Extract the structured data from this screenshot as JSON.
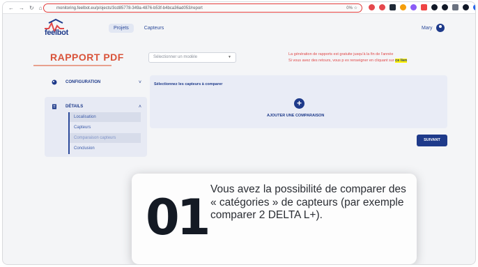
{
  "browser": {
    "url": "monitoring.feelbot.eu/p/ojects/3cd85778-349a-4876-b53f-b4bca36ad053/report",
    "url_right": "0% ☆",
    "nav_icons": [
      "arrow-left-icon",
      "arrow-right-icon",
      "reload-icon",
      "home-icon"
    ],
    "extension_colors": [
      "#e5484d",
      "#e5484d",
      "#1f2937",
      "#f59e0b",
      "#8b5cf6",
      "#ef4444",
      "#111827",
      "#111827",
      "#6b7280",
      "#111827",
      "#2563eb"
    ]
  },
  "app": {
    "logo_text": "feelbot",
    "tabs": [
      {
        "label": "Projets",
        "active": true
      },
      {
        "label": "Capteurs",
        "active": false
      }
    ],
    "user": {
      "name": "Mary",
      "icon": "user-circle-icon"
    }
  },
  "page": {
    "title": "RAPPORT PDF",
    "model_select": {
      "value": "Sélectionner un modèle"
    },
    "notice_line1": "La génération de rapports est gratuite jusqu'à la fin de l'année",
    "notice_line2": "Si vous avez des retours, vous p ex renseigner en cliquant sur",
    "notice_link": "ce lien"
  },
  "sidebar": {
    "configuration": {
      "label": "CONFIGURATION",
      "icon": "palette-icon",
      "chevron": "˅"
    },
    "details": {
      "label": "DÉTAILS",
      "icon": "document-icon",
      "chevron": "˄",
      "items": [
        {
          "label": "Localisation",
          "highlight": true
        },
        {
          "label": "Capteurs",
          "highlight": false
        },
        {
          "label": "Comparaison capteurs",
          "active": true
        },
        {
          "label": "Conclusion",
          "highlight": false
        }
      ]
    }
  },
  "compare_panel": {
    "title": "Sélectionnez les capteurs à comparer",
    "add_button_symbol": "+",
    "add_label": "AJOUTER UNE COMPARAISON"
  },
  "next_button": "SUIVANT",
  "overlay": {
    "number": "01",
    "text": "Vous avez la possibilité de comparer des « catégories » de capteurs (par exemple comparer 2 DELTA L+)."
  },
  "colors": {
    "brand_blue": "#1e3a8a",
    "title_orange": "#d9533a",
    "notice_red": "#e04848",
    "highlight_yellow": "#fff200"
  }
}
